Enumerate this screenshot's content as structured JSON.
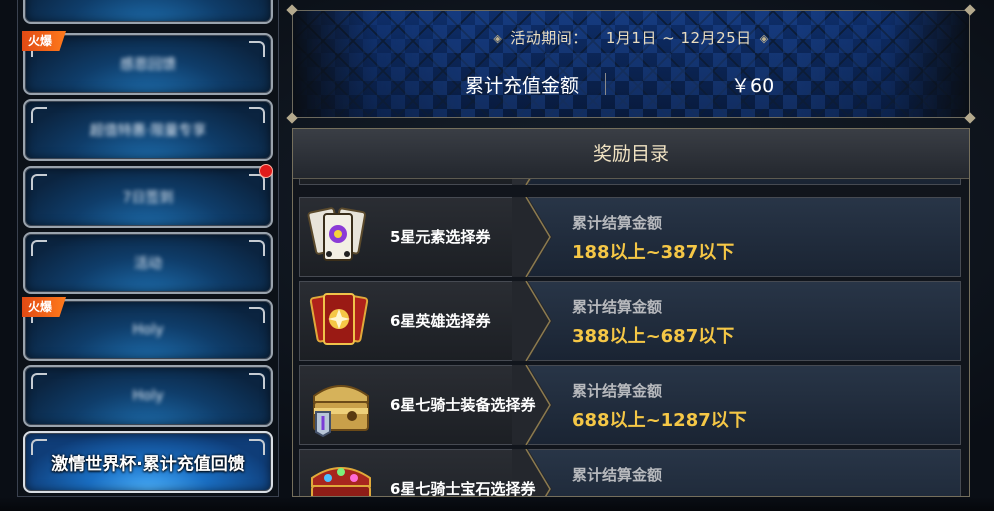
{
  "sidebar": {
    "tabs": [
      {
        "label": "",
        "hot": false,
        "badge": false,
        "active": false
      },
      {
        "label": "感恩回馈",
        "hot": true,
        "badge": false,
        "active": false
      },
      {
        "label": "超值特惠·限量专享",
        "hot": false,
        "badge": false,
        "active": false
      },
      {
        "label": "7日签到",
        "hot": false,
        "badge": true,
        "active": false
      },
      {
        "label": "活动",
        "hot": false,
        "badge": false,
        "active": false
      },
      {
        "label": "Holy",
        "hot": true,
        "badge": false,
        "active": false
      },
      {
        "label": "Holy",
        "hot": false,
        "badge": false,
        "active": false
      },
      {
        "label": "激情世界杯·累计充值回馈",
        "hot": false,
        "badge": false,
        "active": true
      }
    ],
    "hot_tag_text": "火爆"
  },
  "info": {
    "period_label": "活动期间：",
    "period_value": "1月1日 ~ 12月25日",
    "recharge_label": "累计充值金额",
    "recharge_value": "￥60"
  },
  "rewards": {
    "title": "奖励目录",
    "items": [
      {
        "name": "5星元素选择券",
        "cond_label": "累计结算金额",
        "cond_range": "188以上~387以下",
        "icon": "card-bundle-icon"
      },
      {
        "name": "6星英雄选择券",
        "cond_label": "累计结算金额",
        "cond_range": "388以上~687以下",
        "icon": "hero-card-icon"
      },
      {
        "name": "6星七骑士装备选择券",
        "cond_label": "累计结算金额",
        "cond_range": "688以上~1287以下",
        "icon": "equipment-chest-icon"
      },
      {
        "name": "6星七骑士宝石选择券",
        "cond_label": "累计结算金额",
        "cond_range": "",
        "icon": "gem-chest-icon"
      }
    ]
  },
  "colors": {
    "gold_text": "#f5c746",
    "hot_tag": "#ff6a1a",
    "badge_red": "#e01b1b",
    "active_tab": "#1a6fc4"
  }
}
